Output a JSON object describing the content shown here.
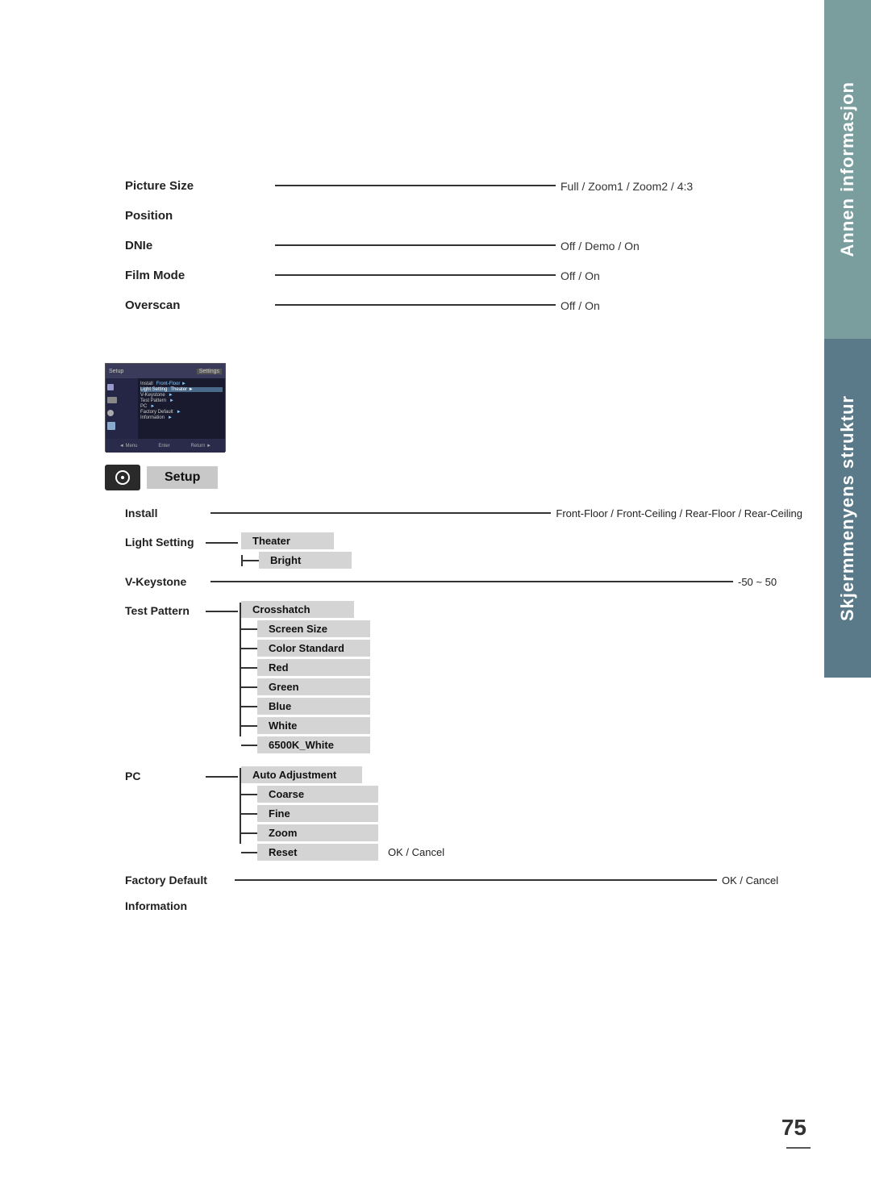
{
  "page": {
    "number": "75",
    "sidebar": {
      "section1_label": "Annen informasjon",
      "section2_label": "Skjermmenyens struktur"
    }
  },
  "top_entries": [
    {
      "label": "Picture Size",
      "value": "Full / Zoom1 / Zoom2 / 4:3",
      "has_line": true
    },
    {
      "label": "Position",
      "value": "",
      "has_line": false
    },
    {
      "label": "DNIe",
      "value": "Off / Demo / On",
      "has_line": true
    },
    {
      "label": "Film Mode",
      "value": "Off / On",
      "has_line": true
    },
    {
      "label": "Overscan",
      "value": "Off / On",
      "has_line": true
    }
  ],
  "setup": {
    "label": "Setup",
    "install_label": "Install",
    "install_value": "Front-Floor / Front-Ceiling / Rear-Floor / Rear-Ceiling",
    "light_setting_label": "Light Setting",
    "light_theater": "Theater",
    "light_bright": "Bright",
    "vkeystone_label": "V-Keystone",
    "vkeystone_value": "-50 ~ 50",
    "test_pattern_label": "Test Pattern",
    "test_crosshatch": "Crosshatch",
    "test_screensize": "Screen Size",
    "test_colorstandard": "Color Standard",
    "test_red": "Red",
    "test_green": "Green",
    "test_blue": "Blue",
    "test_white": "White",
    "test_6500k": "6500K_White",
    "pc_label": "PC",
    "pc_auto": "Auto Adjustment",
    "pc_coarse": "Coarse",
    "pc_fine": "Fine",
    "pc_zoom": "Zoom",
    "pc_reset": "Reset",
    "pc_reset_value": "OK / Cancel",
    "factory_label": "Factory Default",
    "factory_value": "OK / Cancel",
    "information_label": "Information"
  },
  "thumb": {
    "menu_items": [
      {
        "label": "Install",
        "value": "Front-Floor",
        "arrow": "►"
      },
      {
        "label": "Light Setting",
        "value": "Theater",
        "arrow": "►"
      },
      {
        "label": "V-Keystone",
        "value": "",
        "arrow": "►"
      },
      {
        "label": "Test Pattern",
        "value": "",
        "arrow": "►"
      },
      {
        "label": "PC",
        "value": "",
        "arrow": "►"
      },
      {
        "label": "Factory Default",
        "value": "",
        "arrow": "►"
      },
      {
        "label": "Information",
        "value": "",
        "arrow": "►"
      }
    ],
    "bottom_btns": [
      "Menu",
      "Enter",
      "Return"
    ]
  }
}
